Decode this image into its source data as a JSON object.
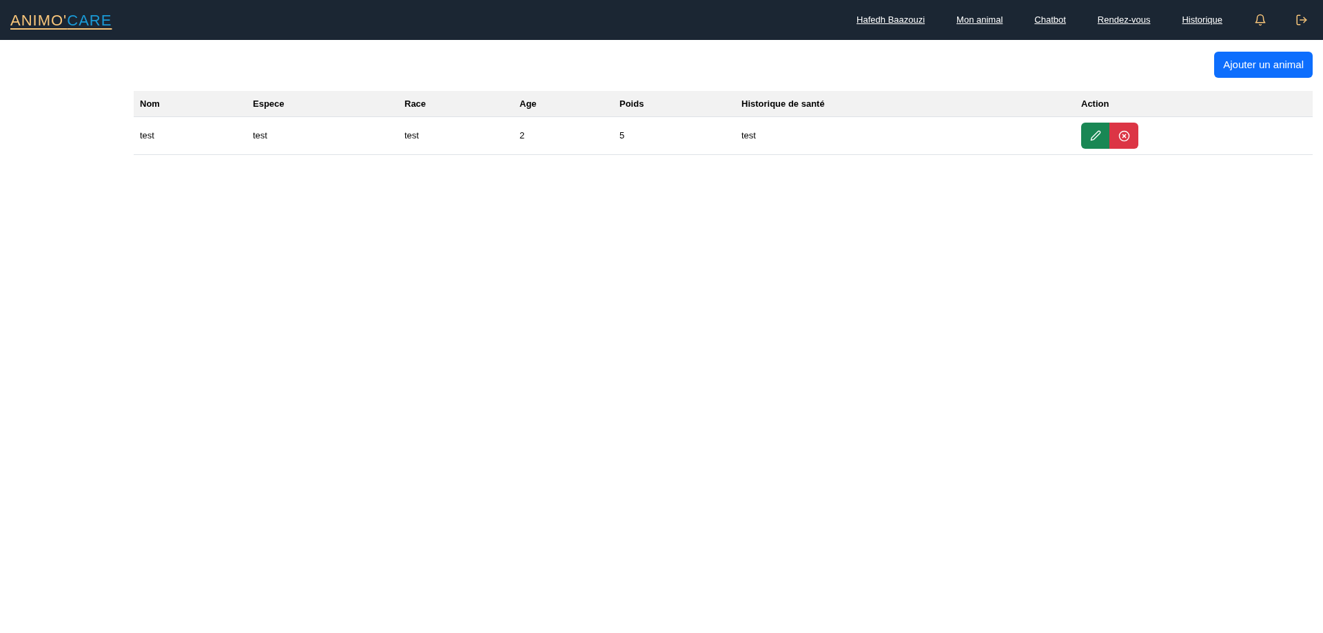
{
  "logo": {
    "first": "ANIMO'",
    "second": "CARE"
  },
  "nav": [
    "Hafedh Baazouzi",
    "Mon animal",
    "Chatbot",
    "Rendez-vous",
    "Historique"
  ],
  "add_button": "Ajouter un animal",
  "table": {
    "columns": [
      "Nom",
      "Espece",
      "Race",
      "Age",
      "Poids",
      "Historique de santé",
      "Action"
    ],
    "rows": [
      {
        "cells": [
          "test",
          "test",
          "test",
          "2",
          "5",
          "test"
        ]
      }
    ]
  }
}
